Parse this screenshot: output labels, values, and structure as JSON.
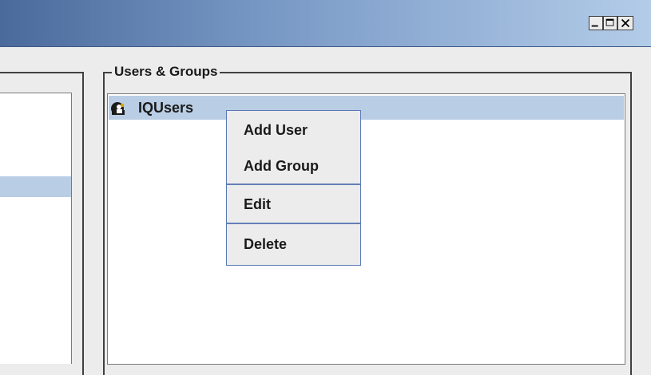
{
  "window": {
    "title": "",
    "controls": {
      "minimize": "_",
      "maximize": "□",
      "close": "×"
    }
  },
  "users_groups_panel": {
    "legend": "Users & Groups",
    "tree": {
      "root": {
        "label": "IQUsers",
        "icon": "users-group-icon",
        "selected": true
      }
    }
  },
  "context_menu": {
    "items": [
      {
        "label": "Add User"
      },
      {
        "label": "Add Group"
      },
      {
        "label": "Edit"
      },
      {
        "label": "Delete"
      }
    ]
  },
  "colors": {
    "selection": "#b9cde5",
    "menu_border": "#5a78b4",
    "titlebar_start": "#4a6a9c",
    "titlebar_end": "#b3cce8"
  }
}
